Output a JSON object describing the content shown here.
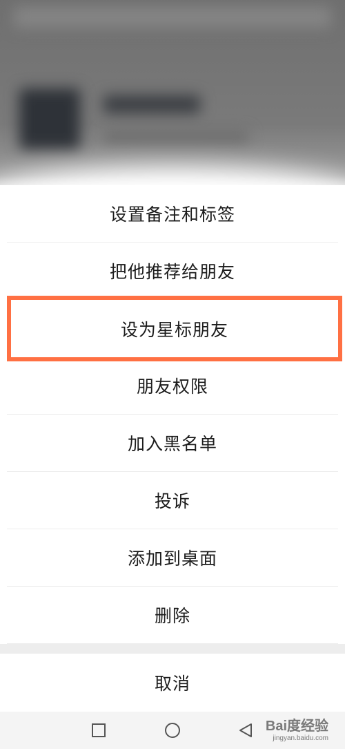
{
  "menu": {
    "items": [
      {
        "label": "设置备注和标签",
        "highlighted": false
      },
      {
        "label": "把他推荐给朋友",
        "highlighted": false
      },
      {
        "label": "设为星标朋友",
        "highlighted": true
      },
      {
        "label": "朋友权限",
        "highlighted": false
      },
      {
        "label": "加入黑名单",
        "highlighted": false
      },
      {
        "label": "投诉",
        "highlighted": false
      },
      {
        "label": "添加到桌面",
        "highlighted": false
      },
      {
        "label": "删除",
        "highlighted": false
      }
    ],
    "cancel_label": "取消"
  },
  "navbar": {
    "icons": [
      "recent-apps-icon",
      "home-icon",
      "back-icon"
    ]
  },
  "watermark": {
    "logo_text": "Bai度经验",
    "url": "jingyan.baidu.com"
  },
  "colors": {
    "highlight_border": "#ff7043",
    "text": "#1c1c1c",
    "divider": "#ececec"
  }
}
